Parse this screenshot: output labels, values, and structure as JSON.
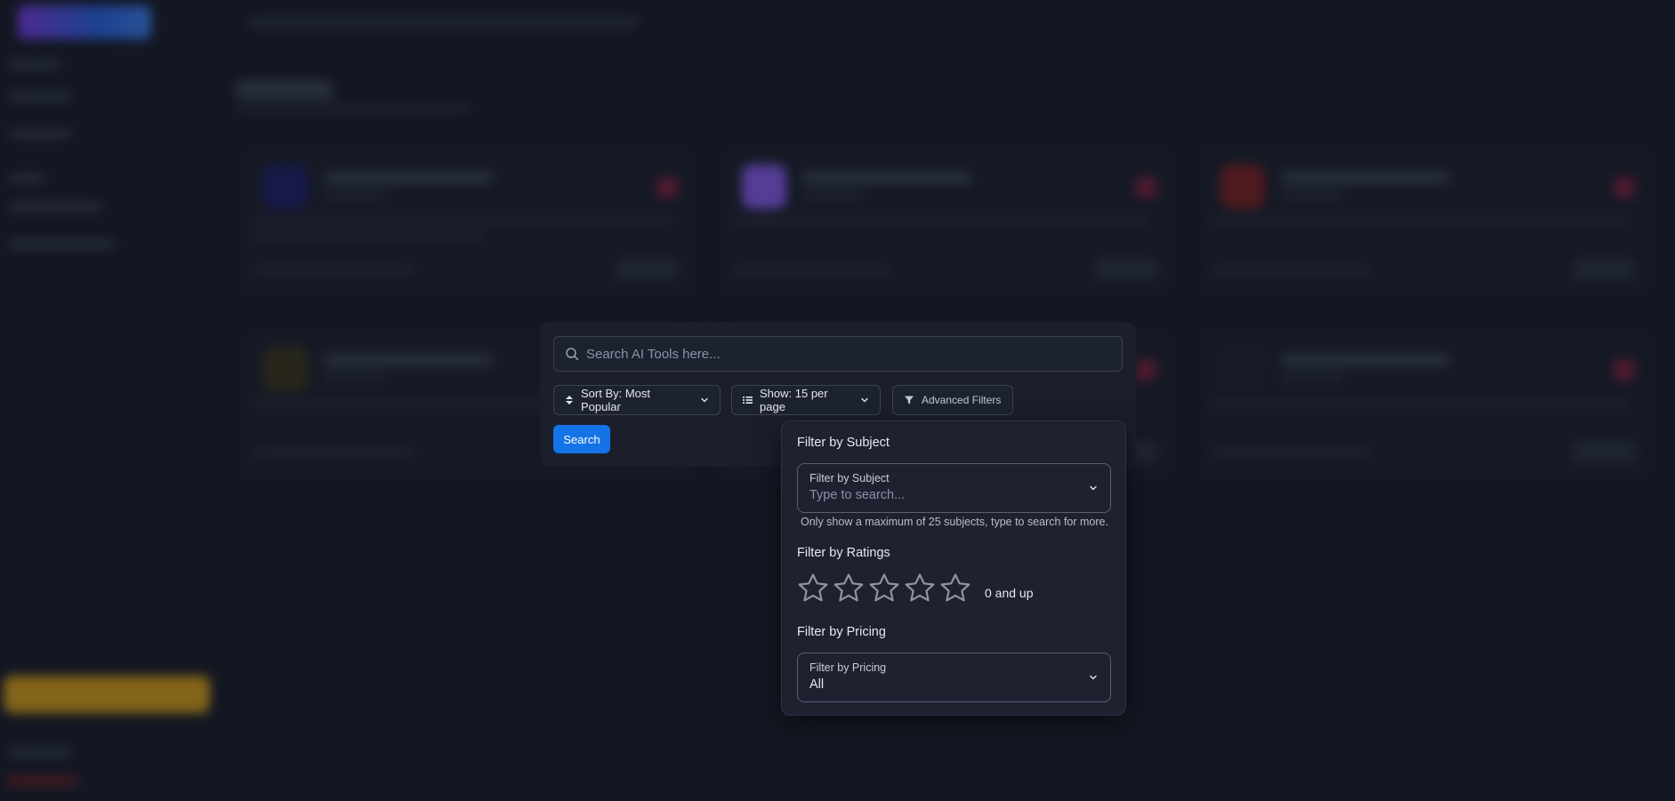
{
  "search": {
    "placeholder": "Search AI Tools here..."
  },
  "controls": {
    "sort_label": "Sort By: Most Popular",
    "show_label": "Show: 15 per page",
    "advanced_filters_label": "Advanced Filters",
    "search_button": "Search"
  },
  "filters": {
    "subject": {
      "title": "Filter by Subject",
      "field_label": "Filter by Subject",
      "placeholder": "Type to search...",
      "helper": "Only show a maximum of 25 subjects, type to search for more."
    },
    "ratings": {
      "title": "Filter by Ratings",
      "stars_total": 5,
      "selected": 0,
      "label": "0 and up"
    },
    "pricing": {
      "title": "Filter by Pricing",
      "field_label": "Filter by Pricing",
      "value": "All"
    }
  },
  "colors": {
    "page_bg": "#131722",
    "panel_bg": "#1b1f2b",
    "popover_bg": "#1d2130",
    "primary_button": "#1473e6",
    "promo": "#e0a313",
    "star_outline": "#8f95a3"
  },
  "icons": {
    "search": "search-icon",
    "sort": "sort-arrows-icon",
    "list": "list-icon",
    "filter": "funnel-icon",
    "chevron": "chevron-down-icon",
    "star": "star-outline-icon"
  }
}
